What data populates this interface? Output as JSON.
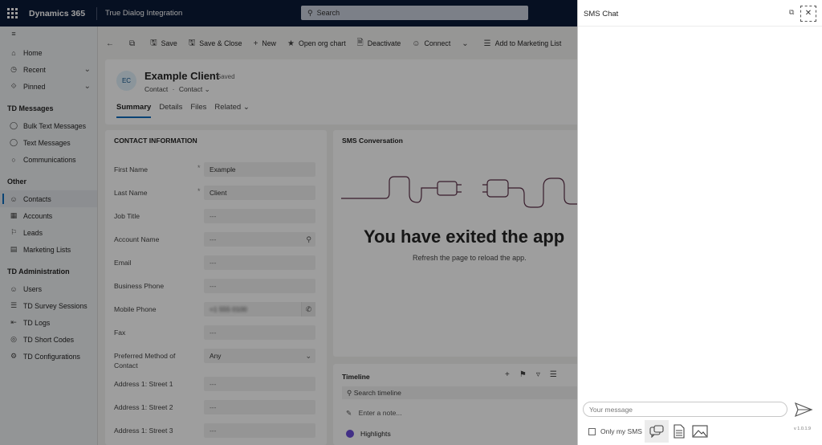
{
  "topbar": {
    "app_name": "Dynamics 365",
    "app_sub": "True Dialog Integration",
    "search_placeholder": "Search"
  },
  "nav": {
    "top": [
      {
        "label": "Home",
        "icon": "home-icon"
      },
      {
        "label": "Recent",
        "icon": "clock-icon"
      },
      {
        "label": "Pinned",
        "icon": "pin-icon"
      }
    ],
    "groups": [
      {
        "title": "TD Messages",
        "items": [
          "Bulk Text Messages",
          "Text Messages",
          "Communications"
        ]
      },
      {
        "title": "Other",
        "items": [
          "Contacts",
          "Accounts",
          "Leads",
          "Marketing Lists"
        ]
      },
      {
        "title": "TD Administration",
        "items": [
          "Users",
          "TD Survey Sessions",
          "TD Logs",
          "TD Short Codes",
          "TD Configurations"
        ]
      }
    ]
  },
  "commands": [
    "Save",
    "Save & Close",
    "New",
    "Open org chart",
    "Deactivate",
    "Connect",
    "Add to Marketing List"
  ],
  "record": {
    "initials": "EC",
    "title": "Example Client",
    "saved": "- Saved",
    "entity": "Contact",
    "form": "Contact",
    "tabs": [
      "Summary",
      "Details",
      "Files",
      "Related"
    ]
  },
  "contact": {
    "title": "CONTACT INFORMATION",
    "fields": [
      {
        "label": "First Name",
        "value": "Example"
      },
      {
        "label": "Last Name",
        "value": "Client"
      },
      {
        "label": "Job Title",
        "value": "---"
      },
      {
        "label": "Account Name",
        "value": "---"
      },
      {
        "label": "Email",
        "value": "---"
      },
      {
        "label": "Business Phone",
        "value": "---"
      },
      {
        "label": "Mobile Phone",
        "value": "+1 555 0100"
      },
      {
        "label": "Fax",
        "value": "---"
      },
      {
        "label": "Preferred Method of Contact",
        "value": "Any"
      },
      {
        "label": "Address 1: Street 1",
        "value": "---"
      },
      {
        "label": "Address 1: Street 2",
        "value": "---"
      },
      {
        "label": "Address 1: Street 3",
        "value": "---"
      }
    ]
  },
  "sms_conversation": {
    "title": "SMS Conversation",
    "exit_title": "You have exited the app",
    "exit_sub": "Refresh the page to reload the app."
  },
  "timeline": {
    "title": "Timeline",
    "search_placeholder": "Search timeline",
    "note_placeholder": "Enter a note...",
    "highlights": "Highlights"
  },
  "sms_chat": {
    "title": "SMS Chat",
    "message_placeholder": "Your message",
    "only_my_sms": "Only my SMS",
    "version": "v 1.0.1.9"
  }
}
